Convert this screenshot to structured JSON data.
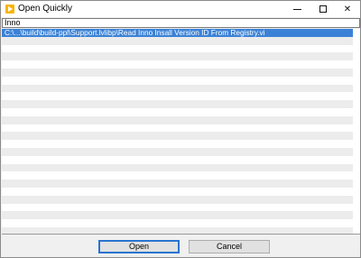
{
  "window": {
    "title": "Open Quickly",
    "controls": {
      "minimize": "minimize",
      "maximize": "maximize",
      "close": "✕"
    }
  },
  "search": {
    "value": "Inno"
  },
  "results": {
    "items": [
      {
        "path": "C:\\...\\build\\build-ppl\\Support.lvlibp\\Read Inno Insall Version ID From Registry.vi",
        "selected": true
      }
    ]
  },
  "buttons": {
    "open_label": "Open",
    "cancel_label": "Cancel"
  },
  "colors": {
    "selection": "#3b82d6",
    "stripe": "#ececec",
    "default_button_border": "#2a74d0",
    "app_icon": "#f7b500"
  },
  "icons": {
    "app": "labview-app-icon"
  }
}
